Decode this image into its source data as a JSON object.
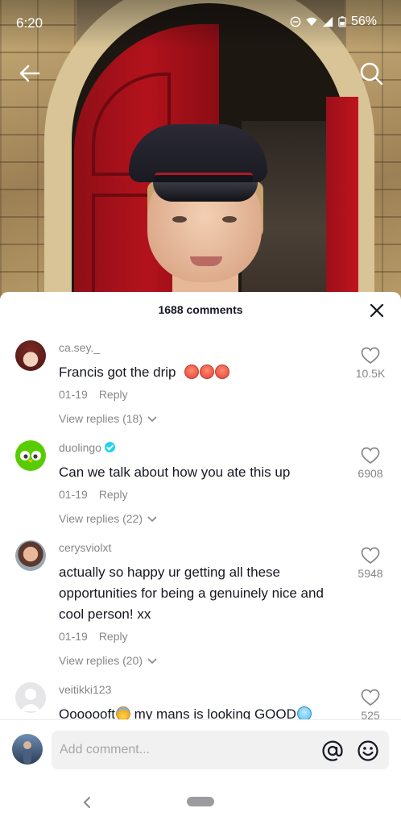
{
  "status_bar": {
    "time": "6:20",
    "battery": "56%",
    "icons": [
      "do-not-disturb-icon",
      "wifi-icon",
      "signal-icon",
      "battery-icon"
    ]
  },
  "video": {
    "back_icon": "arrow-left-icon",
    "search_icon": "search-icon"
  },
  "comments_panel": {
    "title": "1688 comments",
    "close_icon": "close-icon",
    "comments": [
      {
        "username": "ca.sey._",
        "text": "Francis got the drip",
        "emoji": [
          "hot-face",
          "hot-face",
          "hot-face"
        ],
        "date": "01-19",
        "reply_label": "Reply",
        "view_replies": "View replies (18)",
        "likes": "10.5K"
      },
      {
        "username": "duolingo",
        "verified": true,
        "text": "Can we talk about how you ate this up",
        "date": "01-19",
        "reply_label": "Reply",
        "view_replies": "View replies (22)",
        "likes": "6908"
      },
      {
        "username": "cerysviolxt",
        "text": "actually so happy ur getting all these opportunities for being a genuinely nice and cool person! xx",
        "date": "01-19",
        "reply_label": "Reply",
        "view_replies": "View replies (20)",
        "likes": "5948"
      },
      {
        "username": "veitikki123",
        "text_part1": "Ooooooft",
        "text_part2": " my mans is looking GOOD",
        "likes": "525"
      }
    ]
  },
  "composer": {
    "placeholder": "Add comment...",
    "mention_icon": "at-icon",
    "emoji_icon": "smiley-icon"
  },
  "nav_bar": {
    "back_icon": "chevron-left-icon",
    "home_icon": "home-pill-icon"
  },
  "colors": {
    "text_primary": "#161823",
    "text_secondary": "#86878b",
    "verified": "#20d5ec",
    "input_bg": "#f1f1f2"
  }
}
